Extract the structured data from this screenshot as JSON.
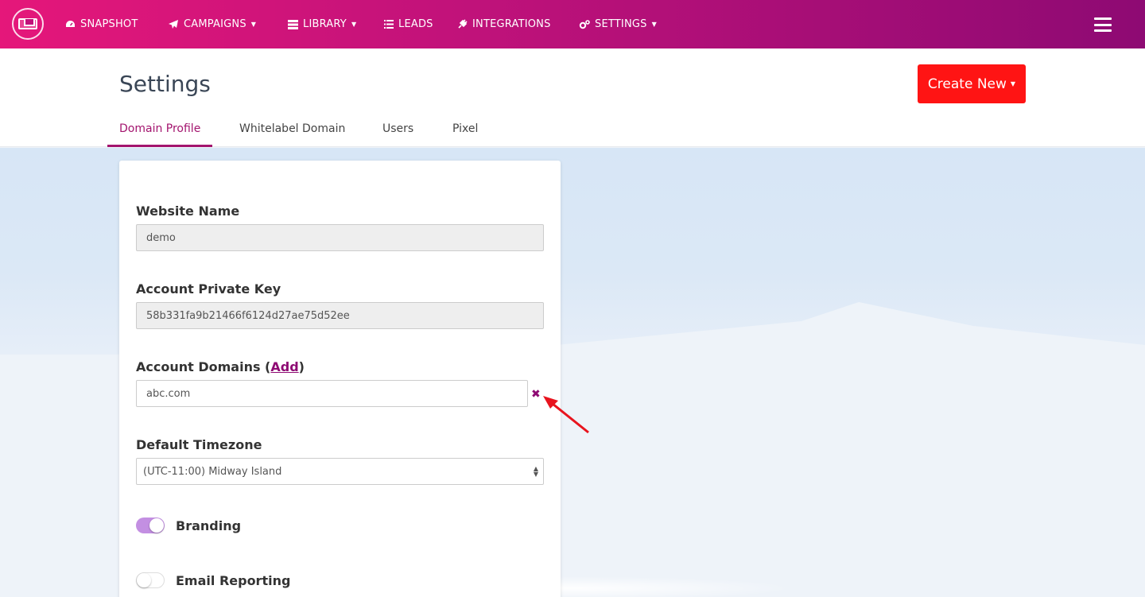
{
  "nav": {
    "items": [
      {
        "label": "SNAPSHOT",
        "icon": "dashboard-icon"
      },
      {
        "label": "CAMPAIGNS",
        "icon": "paper-plane-icon",
        "dropdown": true
      },
      {
        "label": "LIBRARY",
        "icon": "server-icon",
        "dropdown": true
      },
      {
        "label": "LEADS",
        "icon": "list-icon"
      },
      {
        "label": "INTEGRATIONS",
        "icon": "plug-icon"
      },
      {
        "label": "SETTINGS",
        "icon": "cogs-icon",
        "dropdown": true
      }
    ]
  },
  "header": {
    "title": "Settings",
    "create_button": "Create New"
  },
  "tabs": [
    {
      "label": "Domain Profile",
      "active": true
    },
    {
      "label": "Whitelabel Domain"
    },
    {
      "label": "Users"
    },
    {
      "label": "Pixel"
    }
  ],
  "form": {
    "website_name_label": "Website Name",
    "website_name_value": "demo",
    "private_key_label": "Account Private Key",
    "private_key_value": "58b331fa9b21466f6124d27ae75d52ee",
    "domains_label": "Account Domains (",
    "domains_add_link": "Add",
    "domains_label_end": ")",
    "domain_value": "abc.com",
    "remove_icon": "✖",
    "timezone_label": "Default Timezone",
    "timezone_value": "(UTC-11:00) Midway Island",
    "branding_label": "Branding",
    "branding_on": true,
    "email_reporting_label": "Email Reporting",
    "email_reporting_on": false
  },
  "colors": {
    "brand_start": "#e5177a",
    "brand_end": "#8e0a73",
    "accent": "#a3146e",
    "create_button": "#ff1414",
    "annotation_arrow": "#e8141e"
  }
}
